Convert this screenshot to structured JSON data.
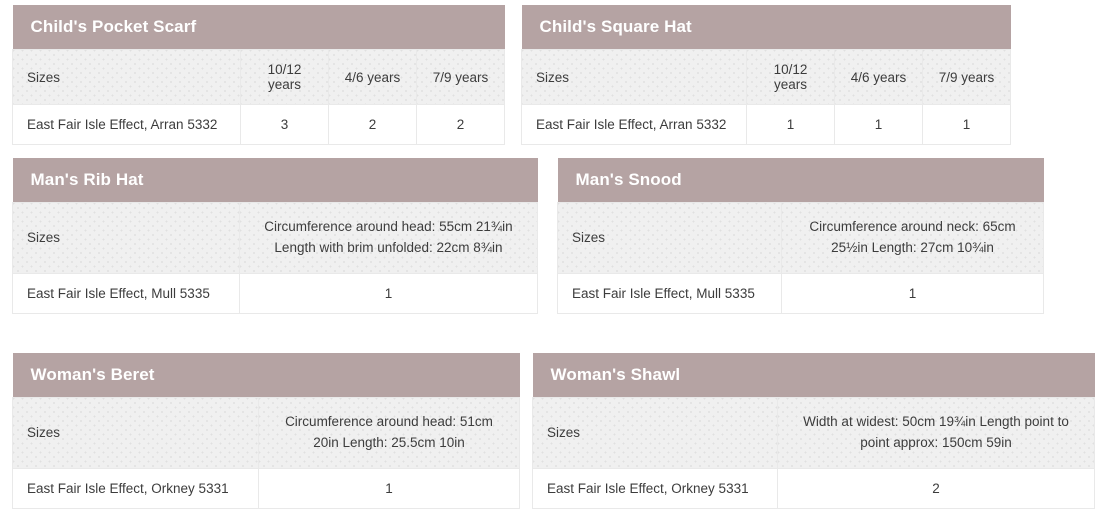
{
  "tables": [
    {
      "id": "childs-pocket-scarf",
      "title": "Child's Pocket Scarf",
      "sizes_label": "Sizes",
      "columns": [
        "10/12 years",
        "4/6 years",
        "7/9 years"
      ],
      "yarn": "East Fair Isle Effect, Arran 5332",
      "quantities": [
        "3",
        "2",
        "2"
      ]
    },
    {
      "id": "childs-square-hat",
      "title": "Child's Square Hat",
      "sizes_label": "Sizes",
      "columns": [
        "10/12 years",
        "4/6 years",
        "7/9 years"
      ],
      "yarn": "East Fair Isle Effect, Arran 5332",
      "quantities": [
        "1",
        "1",
        "1"
      ]
    },
    {
      "id": "mans-rib-hat",
      "title": "Man's Rib Hat",
      "sizes_label": "Sizes",
      "measurements": "Circumference around head: 55cm 21¾in Length with brim unfolded: 22cm 8¾in",
      "yarn": "East Fair Isle Effect, Mull 5335",
      "quantity": "1"
    },
    {
      "id": "mans-snood",
      "title": "Man's Snood",
      "sizes_label": "Sizes",
      "measurements": "Circumference around neck: 65cm 25½in Length: 27cm 10¾in",
      "yarn": "East Fair Isle Effect, Mull 5335",
      "quantity": "1"
    },
    {
      "id": "womans-beret",
      "title": "Woman's Beret",
      "sizes_label": "Sizes",
      "measurements": "Circumference around head: 51cm 20in Length: 25.5cm 10in",
      "yarn": "East Fair Isle Effect, Orkney 5331",
      "quantity": "1"
    },
    {
      "id": "womans-shawl",
      "title": "Woman's Shawl",
      "sizes_label": "Sizes",
      "measurements": "Width at widest: 50cm 19¾in Length point to point approx: 150cm 59in",
      "yarn": "East Fair Isle Effect, Orkney 5331",
      "quantity": "2"
    }
  ],
  "colors": {
    "title_bar": "#b5a3a3",
    "header_row": "#f0f0f0",
    "border": "#e9e9e9",
    "text": "#3c3c3c",
    "title_text": "#ffffff"
  }
}
